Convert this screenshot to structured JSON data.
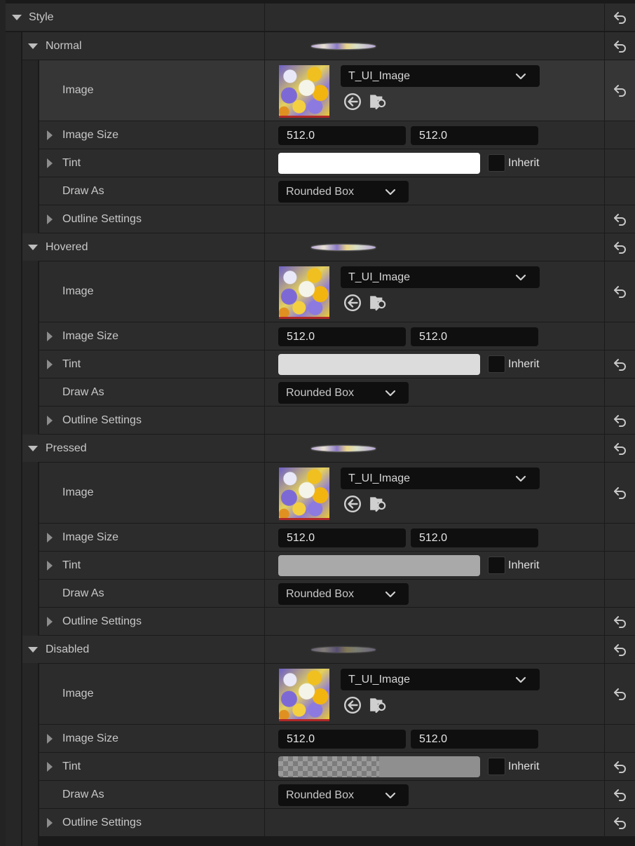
{
  "style": {
    "label": "Style"
  },
  "states": [
    {
      "label": "Normal",
      "image_label": "Image",
      "asset": "T_UI_Image",
      "size_label": "Image Size",
      "size_x": "512.0",
      "size_y": "512.0",
      "tint_label": "Tint",
      "tint_color": "#ffffff",
      "tint_alpha": 1.0,
      "inherit_label": "Inherit",
      "draw_as_label": "Draw As",
      "draw_as_value": "Rounded Box",
      "outline_label": "Outline Settings"
    },
    {
      "label": "Hovered",
      "image_label": "Image",
      "asset": "T_UI_Image",
      "size_label": "Image Size",
      "size_x": "512.0",
      "size_y": "512.0",
      "tint_label": "Tint",
      "tint_color": "#dcdcdc",
      "tint_alpha": 1.0,
      "inherit_label": "Inherit",
      "draw_as_label": "Draw As",
      "draw_as_value": "Rounded Box",
      "outline_label": "Outline Settings"
    },
    {
      "label": "Pressed",
      "image_label": "Image",
      "asset": "T_UI_Image",
      "size_label": "Image Size",
      "size_x": "512.0",
      "size_y": "512.0",
      "tint_label": "Tint",
      "tint_color": "#a9a9a9",
      "tint_alpha": 1.0,
      "inherit_label": "Inherit",
      "draw_as_label": "Draw As",
      "draw_as_value": "Rounded Box",
      "outline_label": "Outline Settings"
    },
    {
      "label": "Disabled",
      "image_label": "Image",
      "asset": "T_UI_Image",
      "size_label": "Image Size",
      "size_x": "512.0",
      "size_y": "512.0",
      "tint_label": "Tint",
      "tint_color": "#8f8f8f",
      "tint_alpha": 0.5,
      "inherit_label": "Inherit",
      "draw_as_label": "Draw As",
      "draw_as_value": "Rounded Box",
      "outline_label": "Outline Settings"
    }
  ],
  "icons": {
    "reset": "reset-to-default-icon",
    "use_selected": "use-selected-asset-icon",
    "browse": "browse-in-content-browser-icon",
    "expand": "chevron-down-icon",
    "collapsed": "caret-right-icon"
  }
}
